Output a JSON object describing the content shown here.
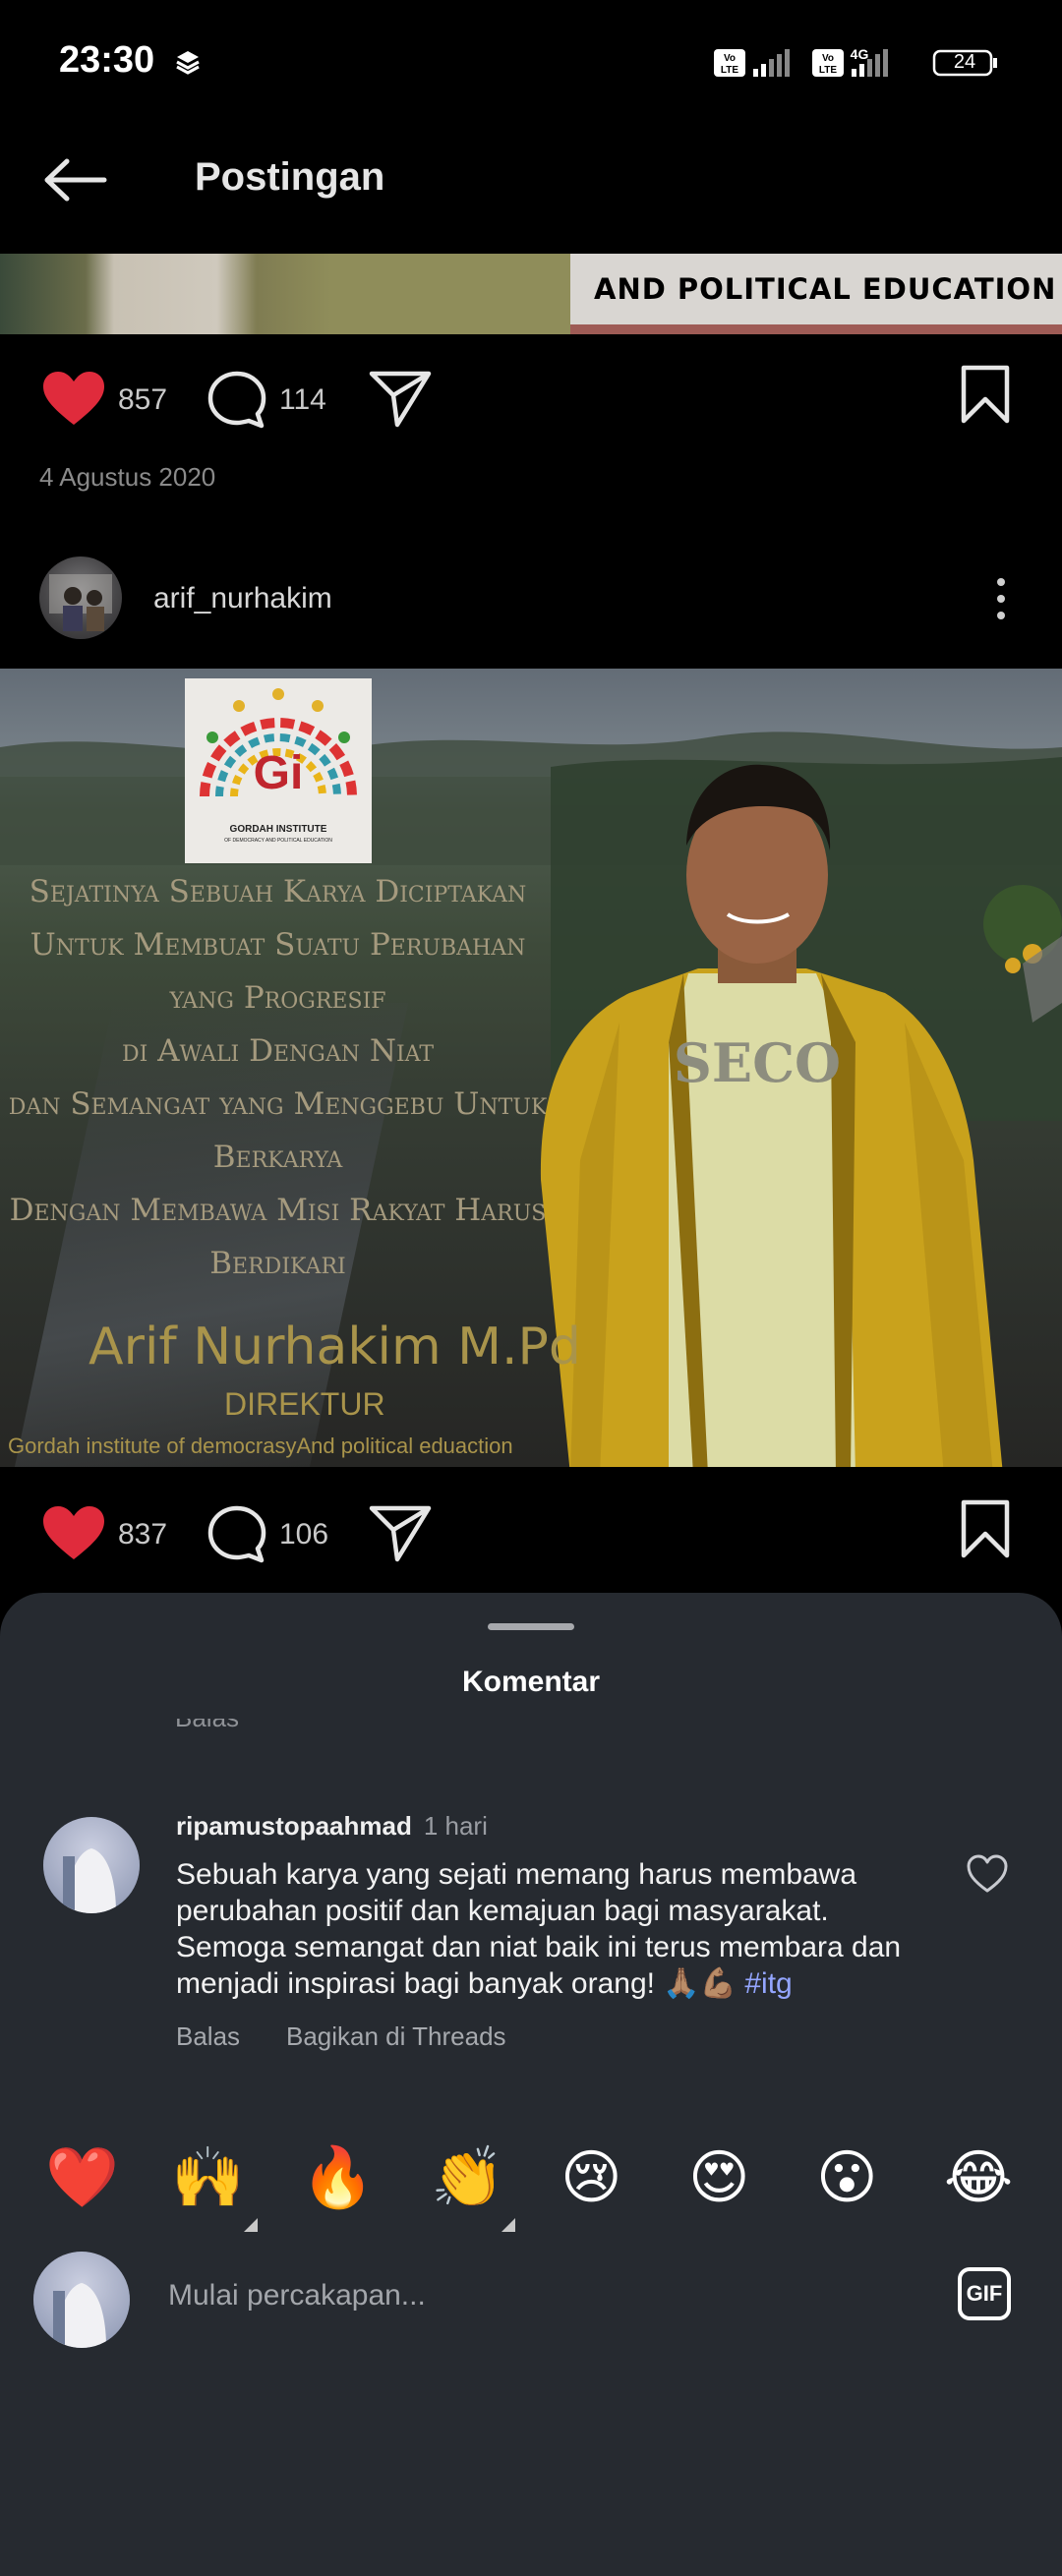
{
  "status_bar": {
    "time": "23:30",
    "battery": "24"
  },
  "header": {
    "title": "Postingan"
  },
  "post1": {
    "banner_text": "AND POLITICAL EDUCATION",
    "likes": "857",
    "comments": "114",
    "date": "4 Agustus 2020"
  },
  "post2": {
    "username": "arif_nurhakim",
    "image_text": {
      "logo_line1": "GORDAH INSTITUTE",
      "logo_line2": "OF DEMOCRACY AND POLITICAL EDUCATION",
      "quote": [
        "Sejatinya Sebuah Karya Diciptakan",
        "Untuk Membuat Suatu Perubahan yang Progresif",
        "di Awali Dengan Niat",
        "dan Semangat yang Menggebu Untuk Berkarya",
        "Dengan Membawa Misi Rakyat Harus Berdikari"
      ],
      "name": "Arif Nurhakim M.Pd",
      "role": "DIREKTUR",
      "org": "Gordah institute of democrasyAnd political eduaction",
      "shirt": "SECO"
    },
    "likes": "837",
    "comments": "106"
  },
  "comments_sheet": {
    "title": "Komentar",
    "partial_text": "Balas",
    "comment": {
      "username": "ripamustopaahmad",
      "time": "1 hari",
      "text": "Sebuah karya yang sejati memang harus membawa perubahan positif dan kemajuan bagi masyarakat. Semoga semangat dan niat baik ini terus membara dan menjadi inspirasi bagi banyak orang! 🙏🏽💪🏽",
      "hashtag": "#itg",
      "reply_label": "Balas",
      "share_label": "Bagikan di Threads"
    },
    "emojis": [
      "❤️",
      "🙌",
      "🔥",
      "👏",
      "😢",
      "😍",
      "😮",
      "😂"
    ],
    "input_placeholder": "Mulai percakapan...",
    "gif_label": "GIF"
  },
  "colors": {
    "like_red": "#e02b3c",
    "sheet_bg": "#262a30",
    "hashtag": "#94a6ff"
  }
}
